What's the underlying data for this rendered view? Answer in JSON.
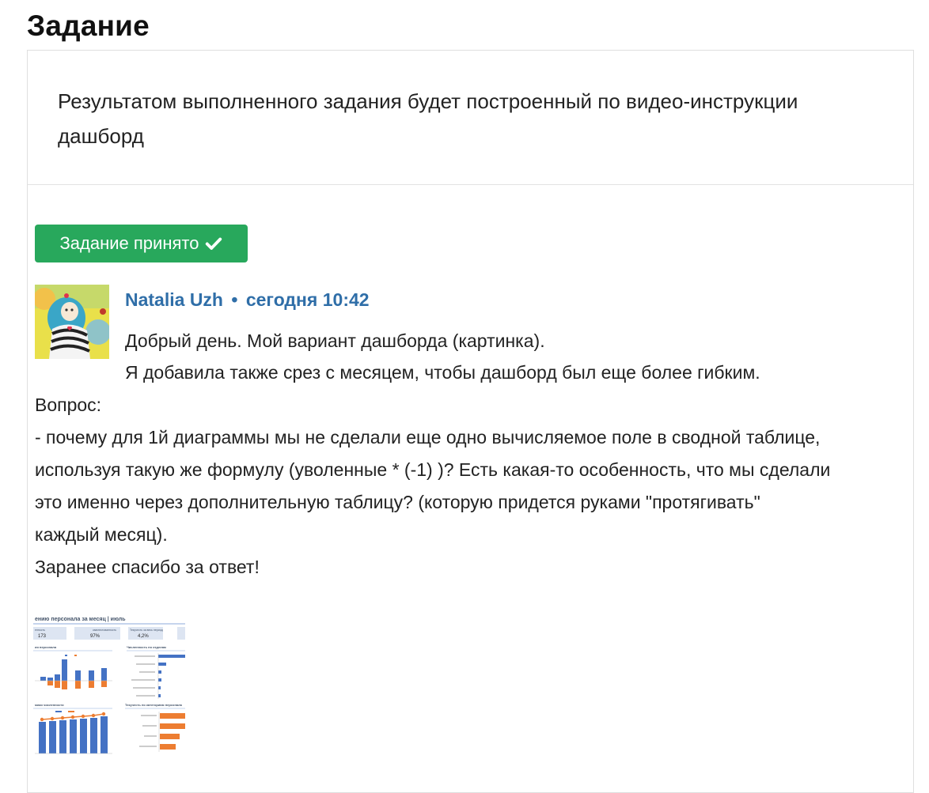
{
  "page": {
    "title": "Задание"
  },
  "task": {
    "text": "Результатом выполненного задания будет построенный по видео-инструкции дашборд"
  },
  "status": {
    "label": "Задание принято",
    "icon": "checkmark-icon",
    "color": "#28a85c"
  },
  "comment": {
    "author": "Natalia Uzh",
    "separator": "•",
    "time": "сегодня 10:42",
    "lines": [
      "Добрый день. Мой вариант дашборда (картинка).",
      "Я добавила также срез с месяцем, чтобы дашборд был еще более гибким.",
      "Вопрос:",
      "- почему для 1й диаграммы мы не сделали еще одно вычисляемое поле в сводной таблице,",
      "используя такую же формулу (уволенные * (-1) )? Есть какая-то особенность, что мы сделали",
      "это именно через дополнительную таблицу? (которую придется руками \"протягивать\"",
      "каждый месяц).",
      "Заранее спасибо за ответ!"
    ]
  },
  "attachment": {
    "header": "ению персонала за месяц | июль",
    "kpis": [
      {
        "label": "енность",
        "value": "173"
      },
      {
        "label": "омплектованность",
        "value": "97%"
      },
      {
        "label": "Текучесть за весь период",
        "value": "4,2%"
      }
    ],
    "section1": "ия персонала",
    "section2": "Численность по отделам",
    "section3": "мики численности",
    "section4": "Текучесть по категориям персонала"
  }
}
